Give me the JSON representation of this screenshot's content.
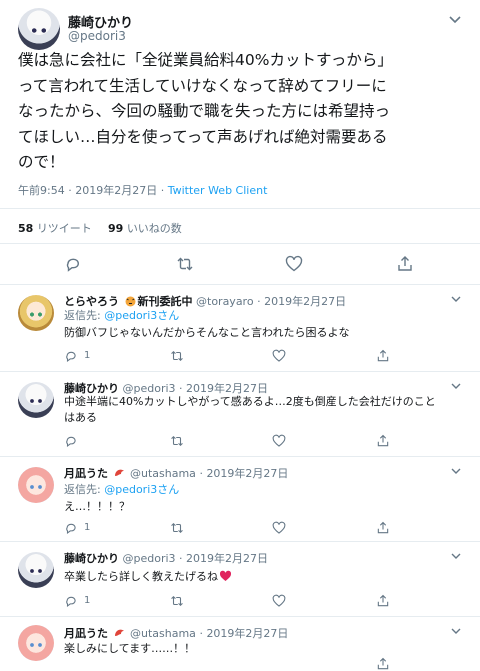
{
  "main": {
    "name": "藤崎ひかり",
    "handle": "@pedori3",
    "text": "僕は急に会社に「全従業員給料40%カットすっから」\nって言われて生活していけなくなって辞めてフリーに\nなったから、今回の騒動で職を失った方には希望持っ\nてほしい…自分を使ってって声あげれば絶対需要ある\nので！",
    "time": "午前9:54",
    "date": "2019年2月27日",
    "client": "Twitter Web Client",
    "retweets": "58",
    "retweets_label": "リツイート",
    "likes": "99",
    "likes_label": "いいねの数",
    "icons": [
      "reply-icon",
      "retweet-icon",
      "like-icon",
      "share-icon"
    ]
  },
  "replies": [
    {
      "name": "とらやろう",
      "suffix": "新刊委託中",
      "handle": "@torayaro",
      "date": "2019年2月27日",
      "reply_to_label": "返信先:",
      "reply_to": "@pedori3さん",
      "text": "防御バフじゃないんだからそんなこと言われたら困るよな",
      "reply_count": "1"
    },
    {
      "name": "藤崎ひかり",
      "handle": "@pedori3",
      "date": "2019年2月27日",
      "text": "中途半端に40%カットしやがって感あるよ…2度も倒産した会社だけのこと\nはある"
    },
    {
      "name": "月凪うた",
      "handle": "@utashama",
      "date": "2019年2月27日",
      "reply_to_label": "返信先:",
      "reply_to": "@pedori3さん",
      "text": "え…！！！？",
      "reply_count": "1"
    },
    {
      "name": "藤崎ひかり",
      "handle": "@pedori3",
      "date": "2019年2月27日",
      "text": "卒業したら詳しく教えたげるね",
      "reply_count": "1"
    },
    {
      "name": "月凪うた",
      "handle": "@utashama",
      "date": "2019年2月27日",
      "text": "楽しみにしてます……！！"
    }
  ],
  "separator": "·",
  "colors": {
    "accent": "#1da1f2",
    "muted": "#657786",
    "border": "#e6ecf0",
    "heart": "#e0245e"
  }
}
